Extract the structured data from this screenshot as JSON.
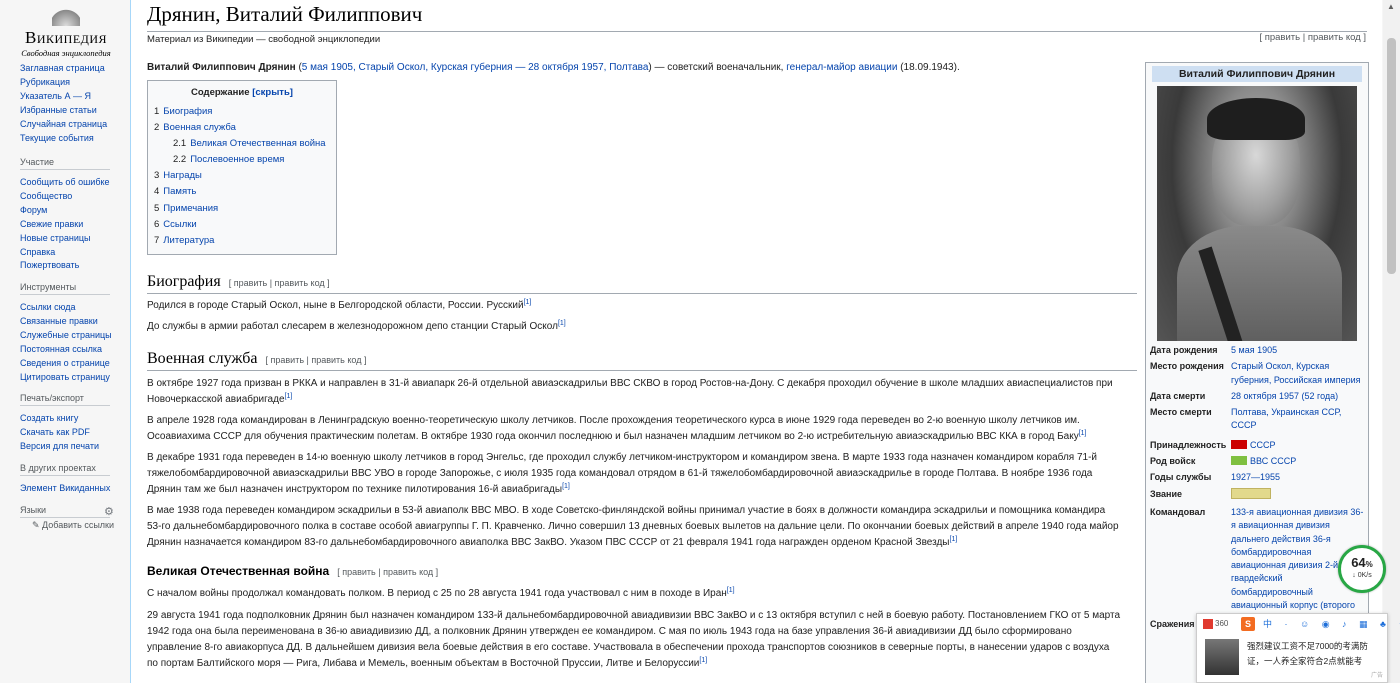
{
  "sidebar": {
    "logo_word": "Википедия",
    "logo_tagline": "Свободная энциклопедия",
    "nav": [
      "Заглавная страница",
      "Рубрикация",
      "Указатель А — Я",
      "Избранные статьи",
      "Случайная страница",
      "Текущие события"
    ],
    "participation": {
      "heading": "Участие",
      "items": [
        "Сообщить об ошибке",
        "Сообщество",
        "Форум",
        "Свежие правки",
        "Новые страницы",
        "Справка",
        "Пожертвовать"
      ]
    },
    "tools": {
      "heading": "Инструменты",
      "items": [
        "Ссылки сюда",
        "Связанные правки",
        "Служебные страницы",
        "Постоянная ссылка",
        "Сведения о странице",
        "Цитировать страницу"
      ]
    },
    "print": {
      "heading": "Печать/экспорт",
      "items": [
        "Создать книгу",
        "Скачать как PDF",
        "Версия для печати"
      ]
    },
    "other_projects": {
      "heading": "В других проектах",
      "items": [
        "Элемент Викиданных"
      ]
    },
    "languages": {
      "heading": "Языки",
      "add_links": "Добавить ссылки"
    }
  },
  "article": {
    "title": "Дрянин, Виталий Филиппович",
    "site_sub": "Материал из Википедии — свободной энциклопедии",
    "top_edit": "[ править | править код ]",
    "lead_bold": "Виталий Филиппович Дрянин",
    "lead_paren_open": " (",
    "lead_birth": "5 мая 1905, Старый Оскол, Курская губерния — 28 октября 1957, Полтава",
    "lead_mid": ") — советский военачальник, ",
    "lead_rank": "генерал-майор авиации",
    "lead_end": " (18.09.1943).",
    "toc": {
      "title": "Содержание",
      "toggle": "[скрыть]",
      "items": [
        {
          "num": "1",
          "label": "Биография"
        },
        {
          "num": "2",
          "label": "Военная служба"
        },
        {
          "num": "2.1",
          "label": "Великая Отечественная война"
        },
        {
          "num": "2.2",
          "label": "Послевоенное время"
        },
        {
          "num": "3",
          "label": "Награды"
        },
        {
          "num": "4",
          "label": "Память"
        },
        {
          "num": "5",
          "label": "Примечания"
        },
        {
          "num": "6",
          "label": "Ссылки"
        },
        {
          "num": "7",
          "label": "Литература"
        }
      ]
    },
    "edit_section": "[ править | править код ]",
    "bio_heading": "Биография",
    "bio_p1": "Родился в городе Старый Оскол, ныне в Белгородской области, России. Русский",
    "bio_p2": "До службы в армии работал слесарем в железнодорожном депо станции Старый Оскол",
    "ref": "[1]",
    "mil_heading": "Военная служба",
    "mil_p1": "В октябре 1927 года призван в РККА и направлен в 31-й авиапарк 26-й отдельной авиаэскадрильи ВВС СКВО в город Ростов-на-Дону. С декабря проходил обучение в школе младших авиаспециалистов при Новочеркасской авиабригаде",
    "mil_p2": "В апреле 1928 года командирован в Ленинградскую военно-теоретическую школу летчиков. После прохождения теоретического курса в июне 1929 года переведен во 2-ю военную школу летчиков им. Осоавиахима СССР для обучения практическим полетам. В октябре 1930 года окончил последнюю и был назначен младшим летчиком во 2-ю истребительную авиаэскадрилью ВВС ККА в город Баку",
    "mil_p3": "В декабре 1931 года переведен в 14-ю военную школу летчиков в город Энгельс, где проходил службу летчиком-инструктором и командиром звена. В марте 1933 года назначен командиром корабля 71-й тяжелобомбардировочной авиаэскадрильи ВВС УВО в городе Запорожье, с июля 1935 года командовал отрядом в 61-й тяжелобомбардировочной авиаэскадрилье в городе Полтава. В ноябре 1936 года Дрянин там же был назначен инструктором по технике пилотирования 16-й авиабригады",
    "mil_p4": "В мае 1938 года переведен командиром эскадрильи в 53-й авиаполк ВВС МВО. В ходе Советско-финляндской войны принимал участие в боях в должности командира эскадрильи и помощника командира 53-го дальнебомбардировочного полка в составе особой авиагруппы Г. П. Кравченко. Лично совершил 13 дневных боевых вылетов на дальние цели. По окончании боевых действий в апреле 1940 года майор Дрянин назначается командиром 83-го дальнебомбардировочного авиаполка ВВС ЗакВО. Указом ПВС СССР от 21 февраля 1941 года награжден орденом Красной Звезды",
    "ww2_heading": "Великая Отечественная война",
    "ww2_p1": "С началом войны продолжал командовать полком. В период с 25 по 28 августа 1941 года участвовал с ним в походе в Иран",
    "ww2_p2": "29 августа 1941 года подполковник Дрянин был назначен командиром 133-й дальнебомбардировочной авиадивизии ВВС ЗакВО и с 13 октября вступил с ней в боевую работу. Постановлением ГКО от 5 марта 1942 года она была переименована в 36-ю авиадивизию ДД, а полковник Дрянин утвержден ее командиром. С мая по июль 1943 года на базе управления 36-й авиадивизии ДД было сформировано управление 8-го авиакорпуса ДД. В дальнейшем дивизия вела боевые действия в его составе. Участвовала в обеспечении прохода транспортов союзников в северные порты, в нанесении ударов с воздуха по портам Балтийского моря — Рига, Либава и Мемель, военным объектам в Восточной Пруссии, Литве и Белоруссии"
  },
  "infobox": {
    "title": "Виталий Филиппович Дрянин",
    "rows": [
      {
        "label": "Дата рождения",
        "value": "5 мая 1905"
      },
      {
        "label": "Место рождения",
        "value": "Старый Оскол, Курская губерния, Российская империя"
      },
      {
        "label": "Дата смерти",
        "value": "28 октября 1957 (52 года)"
      },
      {
        "label": "Место смерти",
        "value": "Полтава, Украинская ССР, СССР"
      },
      {
        "label": "Принадлежность",
        "value": "СССР"
      },
      {
        "label": "Род войск",
        "value": "ВВС СССР"
      },
      {
        "label": "Годы службы",
        "value": "1927—1955"
      },
      {
        "label": "Звание",
        "value": ""
      },
      {
        "label": "Командовал",
        "value": "133-я авиационная дивизия 36-я авиационная дивизия дальнего действия 36-я бомбардировочная авиационная дивизия 2-й гвардейский бомбардировочный авиационный корпус (второго"
      },
      {
        "label": "Сражения",
        "value": ""
      }
    ]
  },
  "speed_widget": {
    "percent": "64",
    "unit": "%",
    "rate": "↓ 0K/s"
  },
  "ime": {
    "brand": "360",
    "sogou": "S",
    "tools": "中 · ☺ ◉ ♪ ▦ ♣ ✦ ⊞",
    "ad_line1": "强烈建议工资不足7000的考满防",
    "ad_line2": "证，一人养全家符合2点就能考",
    "ad_tag": "广告"
  },
  "colors": {
    "link": "#0645ad",
    "accent": "#cedff2",
    "border": "#a2a9b1"
  }
}
